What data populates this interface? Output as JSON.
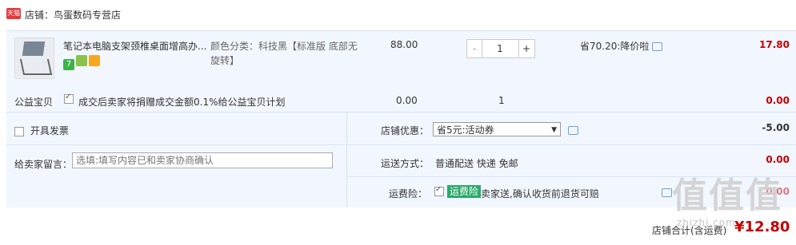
{
  "shop": {
    "badge": "天猫",
    "label": "店铺：鸟蛋数码专营店"
  },
  "item": {
    "title": "笔记本电脑支架颈椎桌面增高办...",
    "sku": "颜色分类：科技黑【标准版 底部无旋转】",
    "unit_price": "88.00",
    "qty_minus": "-",
    "qty": "1",
    "qty_plus": "+",
    "discount": "省70.20:降价啦",
    "subtotal": "17.80",
    "badges": [
      "7",
      "",
      ""
    ]
  },
  "charity": {
    "label": "公益宝贝",
    "text": "成交后卖家将捐赠成交金额0.1%给公益宝贝计划",
    "price": "0.00",
    "qty": "1",
    "subtotal": "0.00"
  },
  "invoice": {
    "label": "开具发票"
  },
  "remark": {
    "label": "给卖家留言：",
    "placeholder": "选填:填写内容已和卖家协商确认"
  },
  "coupon": {
    "label": "店铺优惠：",
    "selected": "省5元:活动券",
    "amount": "-5.00"
  },
  "shipping": {
    "label": "运送方式：",
    "text": "普通配送 快递 免邮",
    "amount": "0.00"
  },
  "insurance": {
    "label": "运费险：",
    "tag": "运费险",
    "text": "卖家送,确认收货前退货可赔",
    "amount": "0.00"
  },
  "total": {
    "label": "店铺合计(含运费)",
    "amount": "¥12.80"
  },
  "watermark": {
    "glyphs": "值值值",
    "url": "zhizhi.com"
  }
}
